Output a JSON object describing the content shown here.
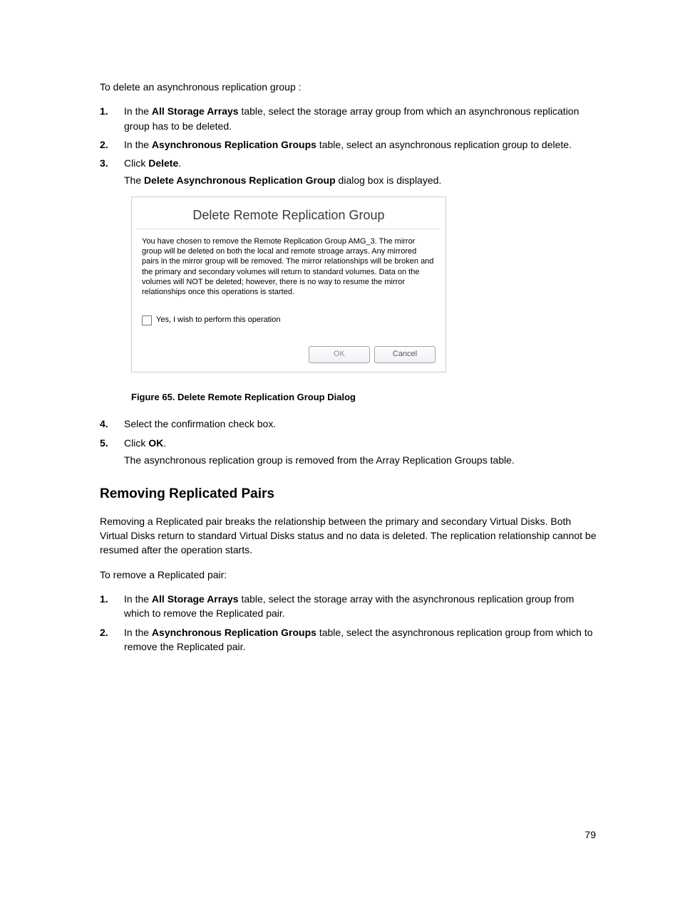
{
  "intro": "To delete an asynchronous replication group :",
  "steps_a": [
    {
      "pre": "In the ",
      "bold": "All Storage Arrays",
      "post": " table, select the storage array group from which an asynchronous replication group has to be deleted."
    },
    {
      "pre": "In the ",
      "bold": "Asynchronous Replication Groups",
      "post": " table, select an asynchronous replication group to delete."
    },
    {
      "pre": "Click ",
      "bold": "Delete",
      "post": "."
    }
  ],
  "after_step3_pre": "The ",
  "after_step3_bold": "Delete Asynchronous Replication Group",
  "after_step3_post": " dialog box is displayed.",
  "dialog": {
    "title": "Delete Remote Replication Group",
    "body": "You have chosen to remove the  Remote Replication Group  AMG_3. The mirror group will be deleted on both the local and remote stroage arrays. Any mirrored pairs in the mirror group will be removed. The mirror relationships will be broken and the primary and secondary volumes will return to standard volumes. Data on the volumes will NOT be deleted; however, there is no way to resume the mirror relationships once this operations is started.",
    "checkbox_label": "Yes, I wish to perform this operation",
    "ok": "OK",
    "cancel": "Cancel"
  },
  "figure_caption": "Figure 65. Delete Remote Replication Group Dialog",
  "steps_b": [
    {
      "pre": "Select the confirmation check box.",
      "bold": "",
      "post": ""
    },
    {
      "pre": "Click ",
      "bold": "OK",
      "post": "."
    }
  ],
  "after_step5": "The asynchronous replication group is removed from the Array Replication Groups table.",
  "section_heading": "Removing Replicated Pairs",
  "section_para": "Removing a Replicated pair breaks the relationship between the primary and secondary Virtual Disks. Both Virtual Disks return to standard Virtual Disks status and no data is deleted. The replication relationship cannot be resumed after the operation starts.",
  "remove_intro": "To remove a Replicated pair:",
  "steps_c": [
    {
      "pre": "In the ",
      "bold": "All Storage Arrays",
      "post": " table, select the storage array with the asynchronous replication group from which to remove the Replicated pair."
    },
    {
      "pre": "In the ",
      "bold": "Asynchronous Replication Groups",
      "post": " table, select the asynchronous replication group from which to remove the Replicated pair."
    }
  ],
  "page_number": "79"
}
